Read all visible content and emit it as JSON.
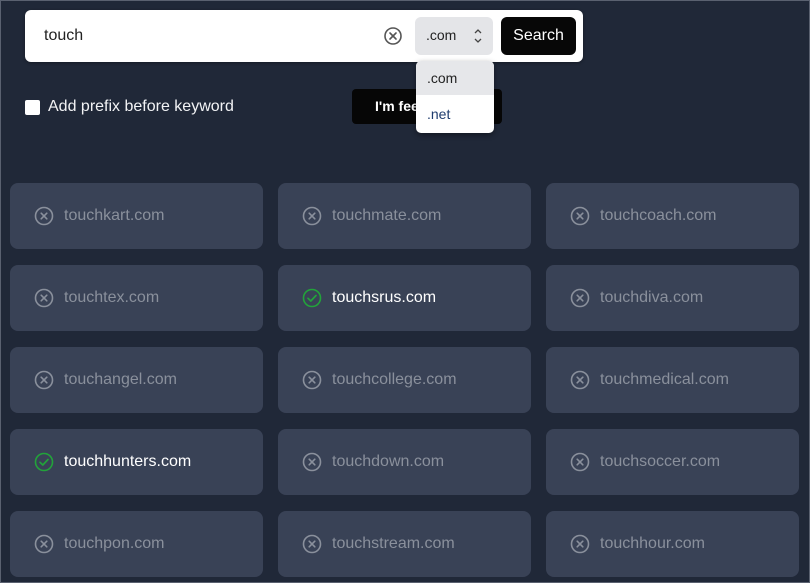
{
  "search": {
    "value": "touch",
    "tld_selected": ".com",
    "button_label": "Search"
  },
  "dropdown": {
    "options": [
      ".com",
      ".net"
    ]
  },
  "options": {
    "prefix_label": "Add prefix before keyword",
    "lucky_label": "I'm feeling lucky"
  },
  "colors": {
    "available": "#22a33a",
    "unavailable": "#8a909c",
    "card_bg": "#394256",
    "page_bg": "#202838"
  },
  "results": [
    {
      "name": "touchkart.com",
      "available": false
    },
    {
      "name": "touchmate.com",
      "available": false
    },
    {
      "name": "touchcoach.com",
      "available": false
    },
    {
      "name": "touchtex.com",
      "available": false
    },
    {
      "name": "touchsrus.com",
      "available": true
    },
    {
      "name": "touchdiva.com",
      "available": false
    },
    {
      "name": "touchangel.com",
      "available": false
    },
    {
      "name": "touchcollege.com",
      "available": false
    },
    {
      "name": "touchmedical.com",
      "available": false
    },
    {
      "name": "touchhunters.com",
      "available": true
    },
    {
      "name": "touchdown.com",
      "available": false
    },
    {
      "name": "touchsoccer.com",
      "available": false
    },
    {
      "name": "touchpon.com",
      "available": false
    },
    {
      "name": "touchstream.com",
      "available": false
    },
    {
      "name": "touchhour.com",
      "available": false
    }
  ]
}
